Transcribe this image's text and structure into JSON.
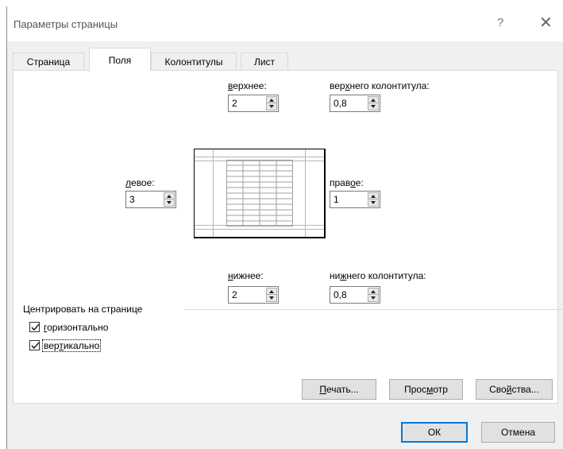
{
  "window": {
    "title": "Параметры страницы",
    "help_icon": "?",
    "close_icon": "✕"
  },
  "tabs": [
    {
      "label": "Страница",
      "active": false
    },
    {
      "label": "Поля",
      "active": true
    },
    {
      "label": "Колонтитулы",
      "active": false
    },
    {
      "label": "Лист",
      "active": false
    }
  ],
  "margins": {
    "top": {
      "label_u": "в",
      "label_rest": "ерхнее:",
      "value": "2"
    },
    "header": {
      "label_pre": "вер",
      "label_u": "х",
      "label_rest": "него колонтитула:",
      "value": "0,8"
    },
    "left": {
      "label_u": "л",
      "label_rest": "евое:",
      "value": "3"
    },
    "right": {
      "label_pre": "прав",
      "label_u": "о",
      "label_rest": "е:",
      "value": "1"
    },
    "bottom": {
      "label_u": "н",
      "label_rest": "ижнее:",
      "value": "2"
    },
    "footer": {
      "label_pre": "ни",
      "label_u": "ж",
      "label_rest": "него колонтитула:",
      "value": "0,8"
    }
  },
  "center": {
    "title": "Центрировать на странице",
    "horizontal": {
      "label_u": "г",
      "label_rest": "оризонтально",
      "checked": true
    },
    "vertical": {
      "label_pre": "вер",
      "label_u": "т",
      "label_rest": "икально",
      "checked": true
    }
  },
  "buttons": {
    "print": {
      "label_u": "П",
      "label_rest": "ечать..."
    },
    "preview": {
      "label_pre": "Прос",
      "label_u": "м",
      "label_rest": "отр"
    },
    "options": {
      "label_pre": "Сво",
      "label_u": "й",
      "label_rest": "ства..."
    },
    "ok": "ОК",
    "cancel": "Отмена"
  },
  "colors": {
    "accent": "#0078d7",
    "dialog_bg": "#f0f0f0"
  }
}
